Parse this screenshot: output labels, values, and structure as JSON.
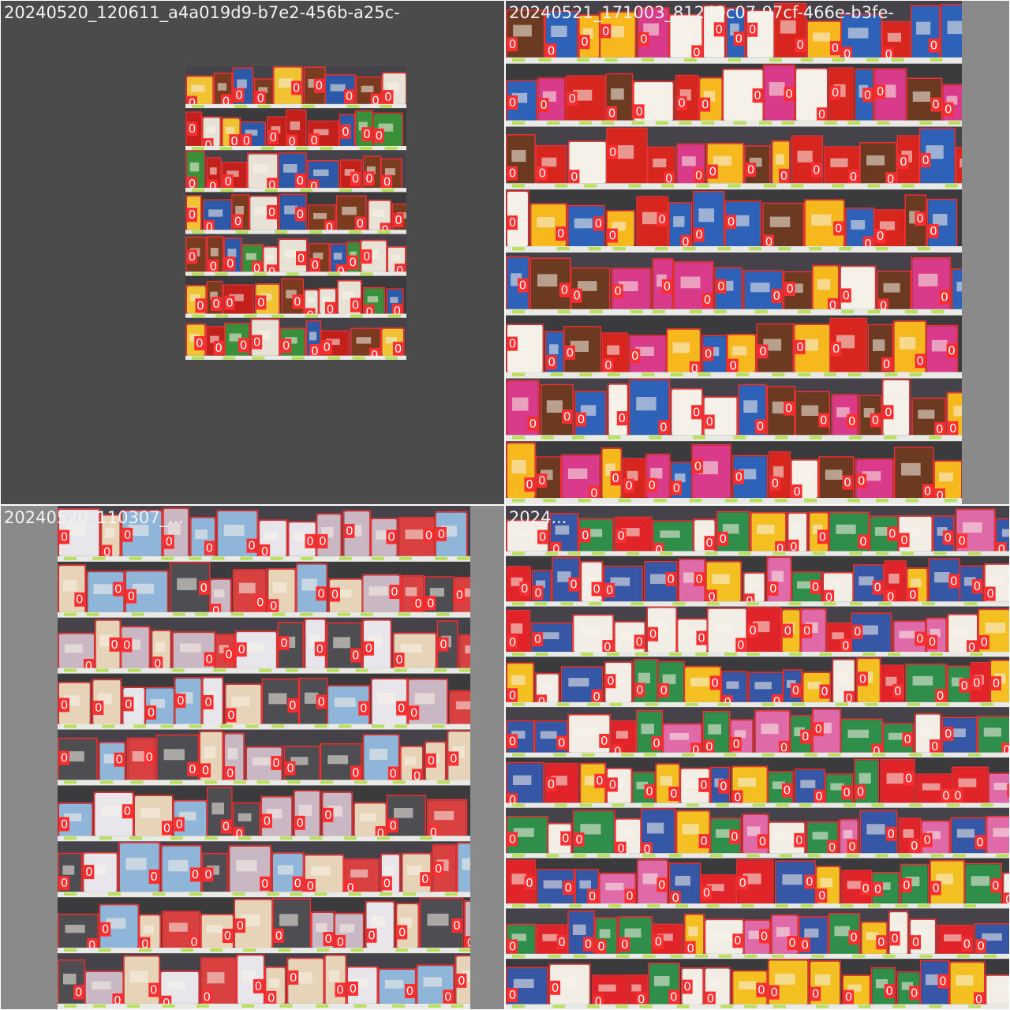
{
  "colors": {
    "letterbox_gray": "#4b4b4b",
    "side_gray": "#8a8a8a",
    "box_red": "#ff2d2d",
    "label_text": "#ffffff",
    "caption_text": "#f2f2f2"
  },
  "tiles": [
    {
      "caption": "20240520_120611_a4a019d9-b7e2-456b-a25c-",
      "scene": "snack shelf photo, small, centered on gray letterbox",
      "box_label": "0",
      "shelf_rows": 7,
      "palette": [
        "#c3201b",
        "#e8e2d6",
        "#2d5aa8",
        "#f1c232",
        "#3a8f3a",
        "#7a3b1f"
      ]
    },
    {
      "caption": "20240521_171003_81249c07-97cf-466e-b3fe-",
      "scene": "convenience store candy shelves with chocolate bar display",
      "box_label": "0",
      "shelf_rows": 8,
      "palette": [
        "#d8261f",
        "#f5f1e8",
        "#2e62b8",
        "#f6b81c",
        "#d93b8a",
        "#6b3a20"
      ]
    },
    {
      "caption": "20240520_110307_...",
      "scene": "rotating snack rack with gift pouches",
      "box_label": "0",
      "shelf_rows": 9,
      "palette": [
        "#e8e6ea",
        "#c9b7c4",
        "#4d4d52",
        "#d94141",
        "#8fb5d8",
        "#e7d4b8"
      ]
    },
    {
      "caption": "2024...",
      "scene": "dense wall of bagged candy and snack packs",
      "box_label": "0",
      "shelf_rows": 10,
      "palette": [
        "#e0242a",
        "#f2eee6",
        "#3557a6",
        "#f4c021",
        "#2f8f4a",
        "#e06aa8"
      ]
    }
  ]
}
